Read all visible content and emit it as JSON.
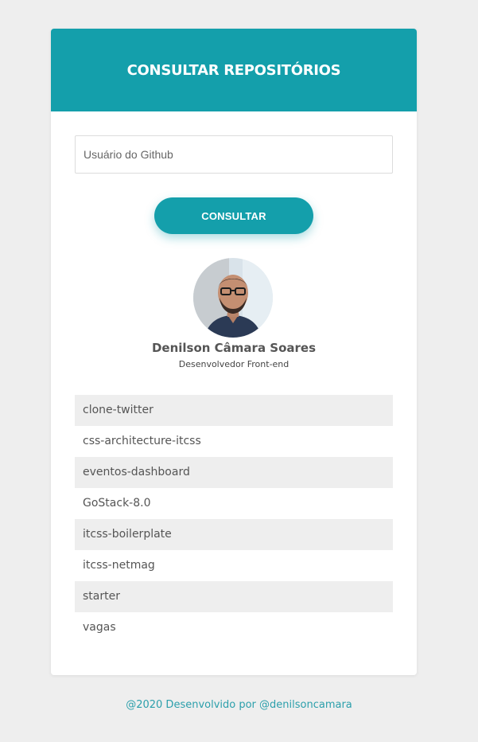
{
  "header": {
    "title": "CONSULTAR REPOSITÓRIOS"
  },
  "search": {
    "placeholder": "Usuário do Github",
    "value": ""
  },
  "consult_button": {
    "label": "CONSULTAR"
  },
  "profile": {
    "name": "Denilson Câmara Soares",
    "role": "Desenvolvedor Front-end"
  },
  "repositories": [
    "clone-twitter",
    "css-architecture-itcss",
    "eventos-dashboard",
    "GoStack-8.0",
    "itcss-boilerplate",
    "itcss-netmag",
    "starter",
    "vagas"
  ],
  "footer": {
    "text": "@2020 Desenvolvido por @denilsoncamara"
  },
  "colors": {
    "accent": "#149fab",
    "background": "#eeeeee",
    "card": "#ffffff",
    "footer_text": "#2b9fab"
  }
}
